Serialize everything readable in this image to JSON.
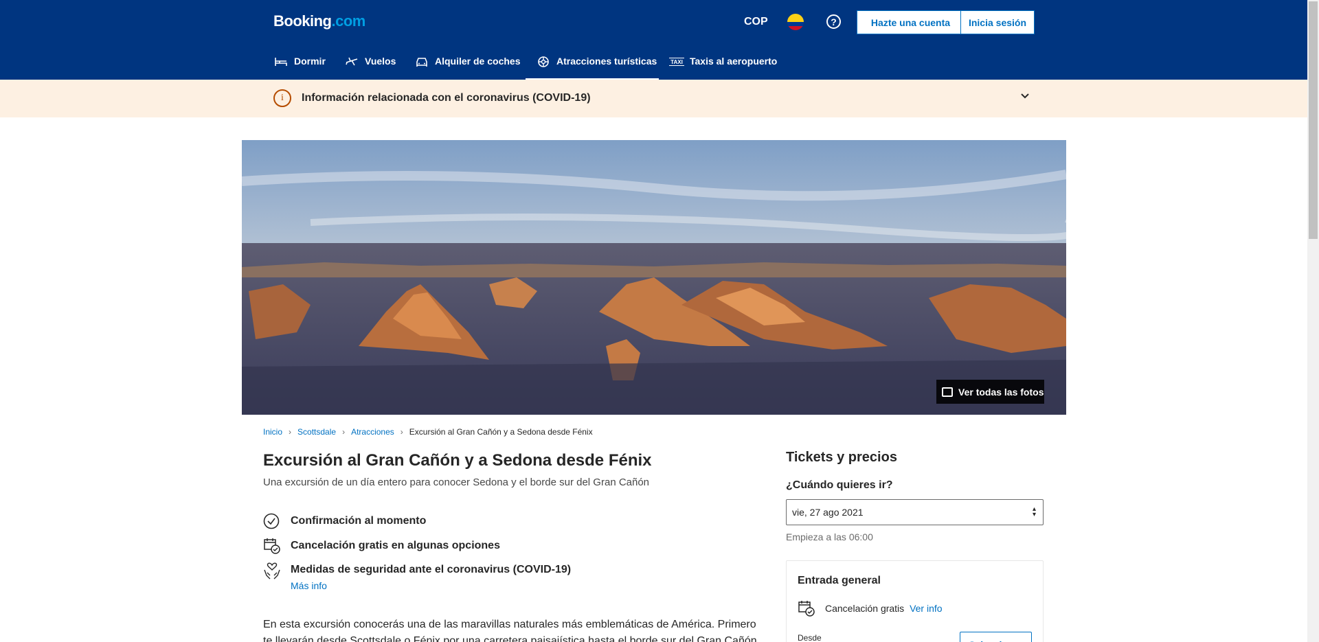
{
  "header": {
    "logo_main": "Booking",
    "logo_domain": ".com",
    "currency": "COP",
    "help_symbol": "?",
    "register_label": "Hazte una cuenta",
    "login_label": "Inicia sesión"
  },
  "nav": {
    "items": [
      {
        "label": "Dormir",
        "icon": "bed-icon"
      },
      {
        "label": "Vuelos",
        "icon": "plane-icon"
      },
      {
        "label": "Alquiler de coches",
        "icon": "car-icon"
      },
      {
        "label": "Atracciones turísticas",
        "icon": "attractions-icon",
        "active": true
      },
      {
        "label": "Taxis al aeropuerto",
        "icon": "taxi-icon"
      }
    ],
    "taxi_badge": "TAXI"
  },
  "covid_banner": {
    "info_symbol": "i",
    "text": "Información relacionada con el coronavirus (COVID-19)"
  },
  "hero": {
    "photos_button": "Ver todas las fotos"
  },
  "breadcrumb": {
    "items": [
      "Inicio",
      "Scottsdale",
      "Atracciones"
    ],
    "current": "Excursión al Gran Cañón y a Sedona desde Fénix"
  },
  "main": {
    "title": "Excursión al Gran Cañón y a Sedona desde Fénix",
    "subtitle": "Una excursión de un día entero para conocer Sedona y el borde sur del Gran Cañón",
    "features": [
      {
        "label": "Confirmación al momento",
        "icon": "check-circle-icon"
      },
      {
        "label": "Cancelación gratis en algunas opciones",
        "icon": "calendar-check-icon"
      },
      {
        "label": "Medidas de seguridad ante el coronavirus (COVID-19)",
        "icon": "heart-hands-icon",
        "link": "Más info"
      }
    ],
    "description": "En esta excursión conocerás una de las maravillas naturales más emblemáticas de América. Primero te llevarán desde Scottsdale o Fénix por una carretera paisajística hasta el borde sur del Gran Cañón y a"
  },
  "tickets": {
    "title": "Tickets y precios",
    "when_label": "¿Cuándo quieres ir?",
    "date_value": "vie, 27 ago 2021",
    "starts_text": "Empieza a las 06:00",
    "card": {
      "title": "Entrada general",
      "cancel_text": "Cancelación gratis",
      "cancel_link": "Ver info",
      "from_label": "Desde",
      "select_label": "Seleccionar"
    }
  },
  "colors": {
    "brand_blue": "#003580",
    "link_blue": "#0071c2",
    "banner_bg": "#fdf0e2",
    "warning_orange": "#b54c00"
  }
}
